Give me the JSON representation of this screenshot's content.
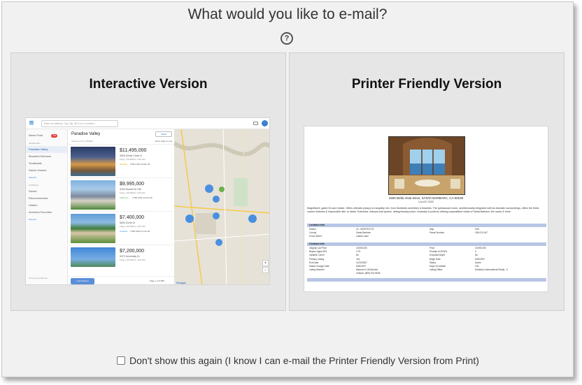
{
  "title": "What would you like to e-mail?",
  "help_icon": "question-mark-icon",
  "options": {
    "interactive": {
      "label": "Interactive Version",
      "preview": {
        "search_placeholder": "Enter an Address, City, Zip, MLS # or Location...",
        "sidebar": {
          "news_feed": "News Feed",
          "news_badge": "105",
          "searches_heading": "SEARCHES",
          "searches": [
            "Paradise Valley",
            "Beautiful Kitchens",
            "Scottsdale",
            "Ranch Homes"
          ],
          "view_all": "View All",
          "listings_heading": "LISTINGS",
          "listings": [
            "Saved",
            "Recommended",
            "Hidden",
            "Archived Favorites"
          ],
          "footer": "Powered by Remine"
        },
        "list": {
          "title": "Paradise Valley",
          "save_button": "SAVE",
          "meta": "Viewing 1-10 of 48,822",
          "sort": "Price: High to Low",
          "cards": [
            {
              "price": "$11,495,000",
              "address": "3929 Greek Circle N",
              "city": "Fargo, ND 58104 • #16-322",
              "status": "Pending",
              "stats": "5 BD   6 BA   10,632 SF"
            },
            {
              "price": "$9,995,000",
              "address": "3233 Sunset Dr SW",
              "city": "Fargo, ND 58104 • #16-322",
              "status": "UCB (Co...",
              "stats": "5 BD   9 BA   14,313 SF"
            },
            {
              "price": "$7,400,000",
              "address": "5634 Circle Dr",
              "city": "Fargo, ND 58104 • #16-322",
              "status": "Contract",
              "stats": "5 BD   8 BA   11,112 SF"
            },
            {
              "price": "$7,200,000",
              "address": "5372 University Dr",
              "city": "Fargo, ND 58104 • #16-322",
              "status": "",
              "stats": ""
            }
          ],
          "load_button": "Load Sixteen",
          "page_text": "Page 1 of 5,883"
        },
        "map": {
          "clusters": [
            "11,462",
            "13,605",
            "11,442",
            "11,643",
            "8,893",
            "6,422"
          ],
          "pins": [
            "Sold",
            "$2.17M"
          ],
          "attribution": "Google"
        }
      }
    },
    "printer": {
      "label": "Printer Friendly Version",
      "preview": {
        "address": "2600 Bella Vista Drive, SANTA BARBARA, CA 93108",
        "list_number": "List #07-2003",
        "description": "Magnificent, gated 32-acre estate. Offers ultimate privacy & tranquility min. from Montecito amenities & beaches. The spectacular home, architecturally integrated with its dramatic surroundings, offers the finest custom features & impeccable attn. to detail. Extensive, lndscpd trail system, dining/viewing tower, verandas & porticos offering unparalleled vistas of Santa Barbara, the ocean & mtns.",
        "sections": [
          {
            "heading": "Location Info",
            "rows": [
              [
                "District",
                "10 - MONTECITO",
                "Map",
                "G20"
              ],
              [
                "County",
                "Santa Barbara",
                "Parcel Number",
                "155-010-047"
              ],
              [
                "Cross Street",
                "Ladera Lane",
                "",
                ""
              ]
            ]
          },
          {
            "heading": "Contract Info",
            "rows": [
              [
                "Original List Price",
                "15,950,000",
                "Price",
                "15,950,000"
              ],
              [
                "Buyers Agent $/%",
                "2.75",
                "Probate UCB $/%",
                "0"
              ],
              [
                "Variable Comm",
                "No",
                "Excluded Buyer",
                "No"
              ],
              [
                "Primary Listing",
                "Yes",
                "Begin Date",
                "6/26/2007"
              ],
              [
                "End Date",
                "12/10/2007",
                "Status",
                "Active"
              ],
              [
                "Status Change Date",
                "6/26/2007",
                "Days On Market",
                "125"
              ],
              [
                "Listing Member",
                "Maureen K McDermut",
                "Listing Office",
                "Sotheby's International Realty - 5"
              ],
              [
                "",
                "Cellular: (805) 570-5545",
                "",
                ""
              ]
            ]
          }
        ]
      }
    }
  },
  "dont_show": {
    "checked": false,
    "label": "Don't show this again (I know I can e-mail the Printer Friendly Version from Print)"
  }
}
